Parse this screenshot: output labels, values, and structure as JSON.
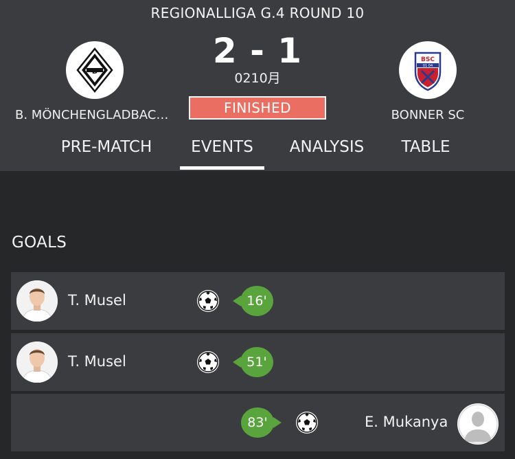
{
  "match": {
    "round": "REGIONALLIGA G.4 ROUND 10",
    "score": "2 - 1",
    "date": "0210月",
    "status": "FINISHED"
  },
  "home_team": {
    "name": "B. MÖNCHENGLADBACH...",
    "logo_icon": "gladbach-crest-icon"
  },
  "away_team": {
    "name": "BONNER SC",
    "logo_icon": "bonner-sc-crest-icon"
  },
  "tabs": [
    {
      "label": "PRE-MATCH"
    },
    {
      "label": "EVENTS",
      "active": true
    },
    {
      "label": "ANALYSIS"
    },
    {
      "label": "TABLE"
    }
  ],
  "goals": {
    "title": "GOALS",
    "events": [
      {
        "player": "T. Musel",
        "minute": "16'",
        "side": "home"
      },
      {
        "player": "T. Musel",
        "minute": "51'",
        "side": "home"
      },
      {
        "player": "E. Mukanya",
        "minute": "83'",
        "side": "away"
      }
    ]
  },
  "colors": {
    "header_bg": "#3a3c3f",
    "page_bg": "#262728",
    "status_bg": "#eb6e63",
    "minute_bg": "#5aa43e"
  }
}
